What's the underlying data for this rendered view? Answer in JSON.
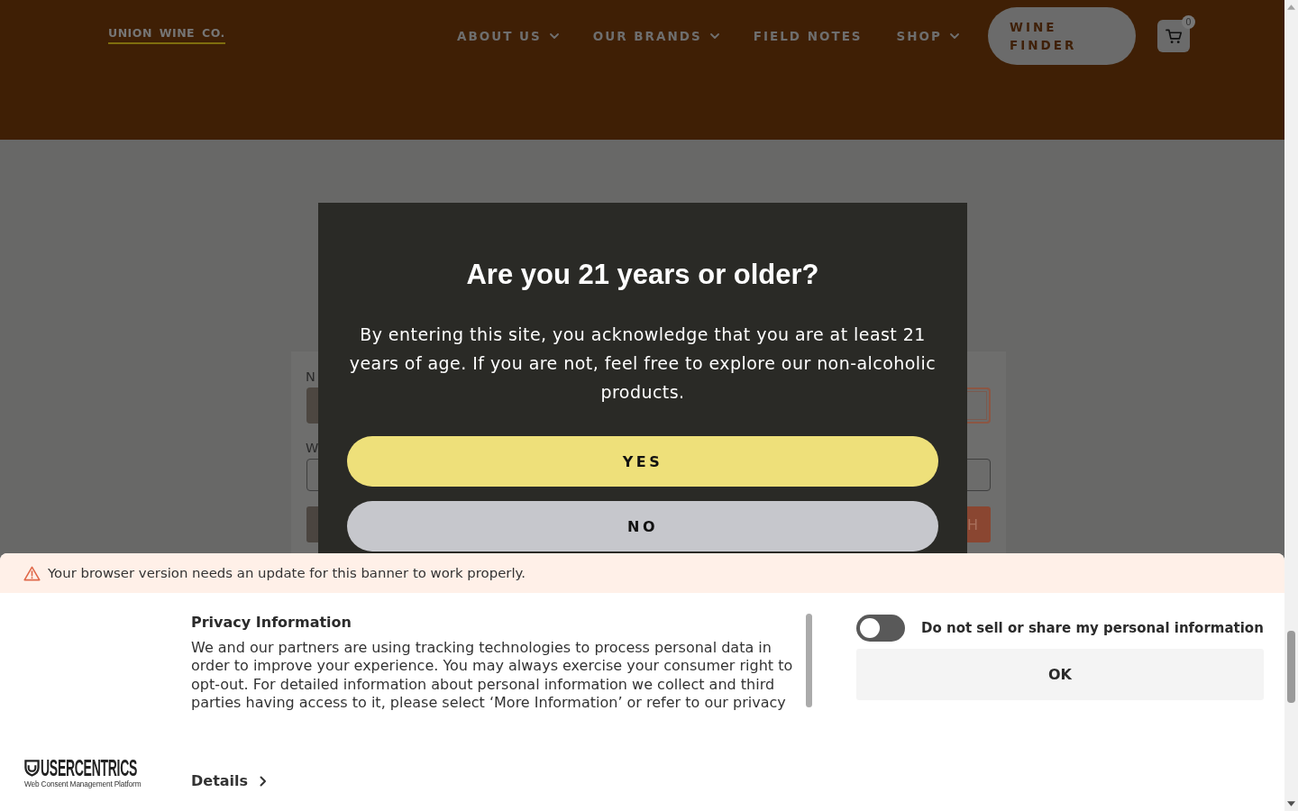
{
  "header": {
    "logo": "UNION WINE CO.",
    "nav": [
      {
        "label": "ABOUT US",
        "dropdown": true
      },
      {
        "label": "OUR BRANDS",
        "dropdown": true
      },
      {
        "label": "FIELD NOTES",
        "dropdown": false
      },
      {
        "label": "SHOP",
        "dropdown": true
      }
    ],
    "wine_finder": "WINE FINDER",
    "cart_count": "0"
  },
  "search_form": {
    "rows": [
      {
        "label": "N",
        "fields": [
          {
            "kind": "select",
            "focused": false
          },
          {
            "kind": "input",
            "focused": true
          }
        ]
      },
      {
        "label": "W",
        "fields": [
          {
            "kind": "input",
            "focused": false
          }
        ]
      }
    ],
    "buttons": [
      {
        "kind": "secondary"
      },
      {
        "kind": "primary",
        "label": "H"
      }
    ]
  },
  "age_modal": {
    "title": "Are you 21 years or older?",
    "body": "By entering this site, you acknowledge that you are at least 21 years of age. If you are not, feel free to explore our non-alcoholic products.",
    "buttons": [
      {
        "kind": "primary",
        "label": "YES"
      },
      {
        "kind": "secondary",
        "label": "NO"
      }
    ]
  },
  "cookie_banner": {
    "warning": "Your browser version needs an update for this banner to work properly.",
    "logo": {
      "name": "USERCENTRICS",
      "tagline": "Web Consent Management Platform"
    },
    "title": "Privacy Information",
    "text": "We and our partners are using tracking technologies to process personal data in order to improve your experience. You may always exercise your consumer right to opt-out. For detailed information about personal information we collect and third parties having access to it, please select ‘More Information’ or refer to our privacy",
    "details_link": "Details",
    "toggle": {
      "label": "Do not sell or share my personal information",
      "on": false
    },
    "ok_button": "OK"
  }
}
